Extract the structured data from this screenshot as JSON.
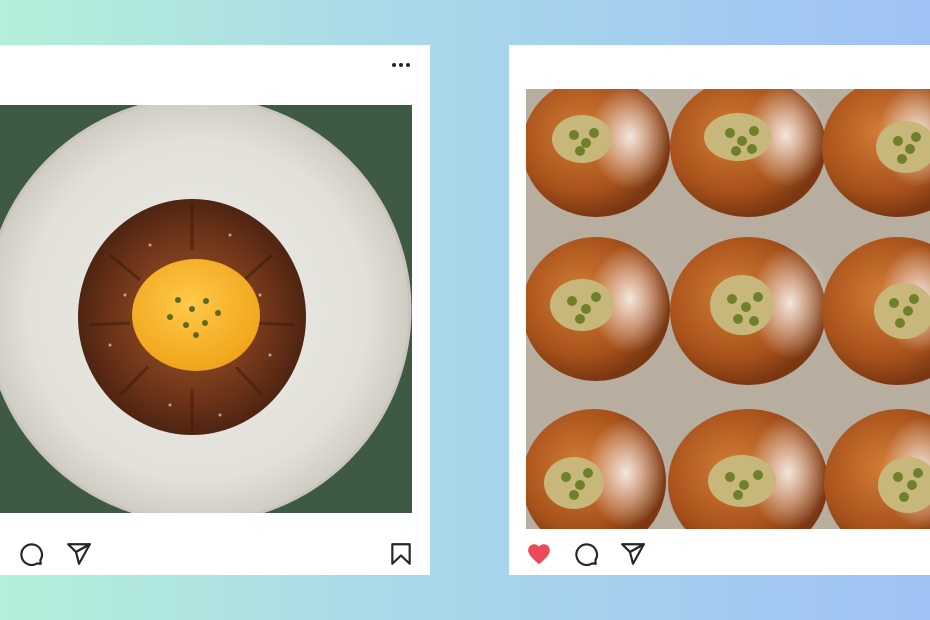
{
  "posts": [
    {
      "menu_icon": "more-horizontal-icon",
      "photo_subject": "pastry",
      "actions": {
        "comment_icon": "comment-icon",
        "share_icon": "share-icon",
        "save_icon": "bookmark-icon"
      }
    },
    {
      "photo_subject": "buns",
      "actions": {
        "like_icon": "heart-filled-icon",
        "comment_icon": "comment-icon",
        "share_icon": "share-icon"
      },
      "liked": true
    }
  ],
  "colors": {
    "background_start": "#b5efd9",
    "background_end": "#9fc2f5",
    "card": "#ffffff",
    "icon": "#262626",
    "like": "#ed4956"
  }
}
